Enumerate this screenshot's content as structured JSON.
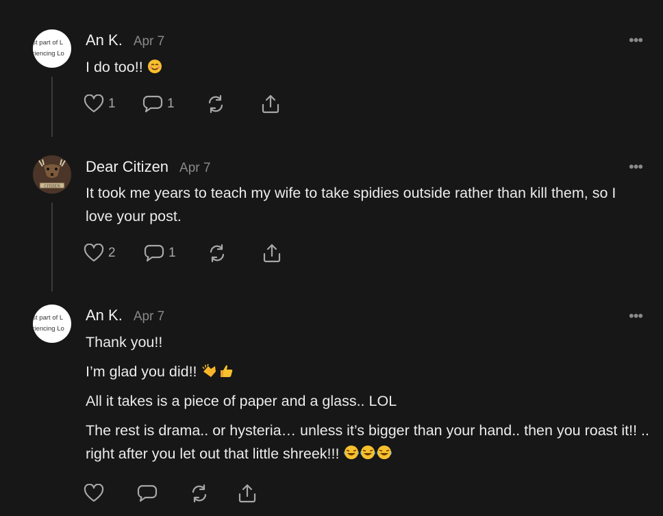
{
  "comments": [
    {
      "author": "An K.",
      "date": "Apr 7",
      "avatar_lines": [
        "est part of L",
        "eriencing Lo"
      ],
      "paragraphs": [
        "I do too!!"
      ],
      "likes": "1",
      "replies": "1"
    },
    {
      "author": "Dear Citizen",
      "date": "Apr 7",
      "avatar_label": "CITIZEN",
      "paragraphs": [
        "It took me years to teach my wife to take spidies outside rather than kill them, so I love your post."
      ],
      "likes": "2",
      "replies": "1"
    },
    {
      "author": "An K.",
      "date": "Apr 7",
      "avatar_lines": [
        "est part of L",
        "eriencing Lo"
      ],
      "paragraphs": [
        "Thank you!!",
        "I’m glad you did!!",
        "All it takes is a piece of paper and a glass.. LOL",
        "The rest is drama.. or hysteria… unless it’s bigger than your hand.. then you roast it!! .. right after you let out that little shreek!!!"
      ],
      "likes": "",
      "replies": ""
    }
  ],
  "more_glyph": "•••",
  "icons": [
    "heart-icon",
    "comment-icon",
    "restack-icon",
    "share-icon",
    "more-icon"
  ]
}
